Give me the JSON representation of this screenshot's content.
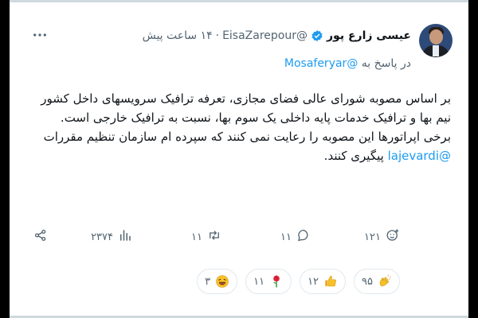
{
  "tweet": {
    "author_name": "عیسی زارع پور",
    "author_handle": "@EisaZarepour",
    "dot": "·",
    "time": "۱۴ ساعت پیش",
    "reply_prefix": "در پاسخ به",
    "reply_handle": "@Mosaferyar",
    "body_lines": [
      "بر اساس مصوبه شورای عالی فضای مجازی، تعرفه ترافیک سرویسهای داخل کشور",
      "نیم بها و ترافیک خدمات پایه داخلی یک سوم بها، نسبت به ترافیک خارجی است.",
      "برخی اپراتورها این مصوبه را رعایت نمی کنند که سپرده ام سازمان تنظیم مقررات"
    ],
    "body_mention": "@lajevardi",
    "body_last_rest": " پیگیری کنند."
  },
  "actions": {
    "reactions_count": "۱۲۱",
    "reply_count": "۱۱",
    "retweet_count": "۱۱",
    "views_count": "۲۳۷۴"
  },
  "reactions": [
    {
      "emoji": "clapping-hands",
      "count": "۹۵"
    },
    {
      "emoji": "thumbs-up",
      "count": "۱۲"
    },
    {
      "emoji": "rose",
      "count": "۱۱"
    },
    {
      "emoji": "laughing-face",
      "count": "۳"
    }
  ],
  "colors": {
    "accent": "#1d9bf0",
    "muted": "#536471",
    "text": "#0f1419"
  }
}
